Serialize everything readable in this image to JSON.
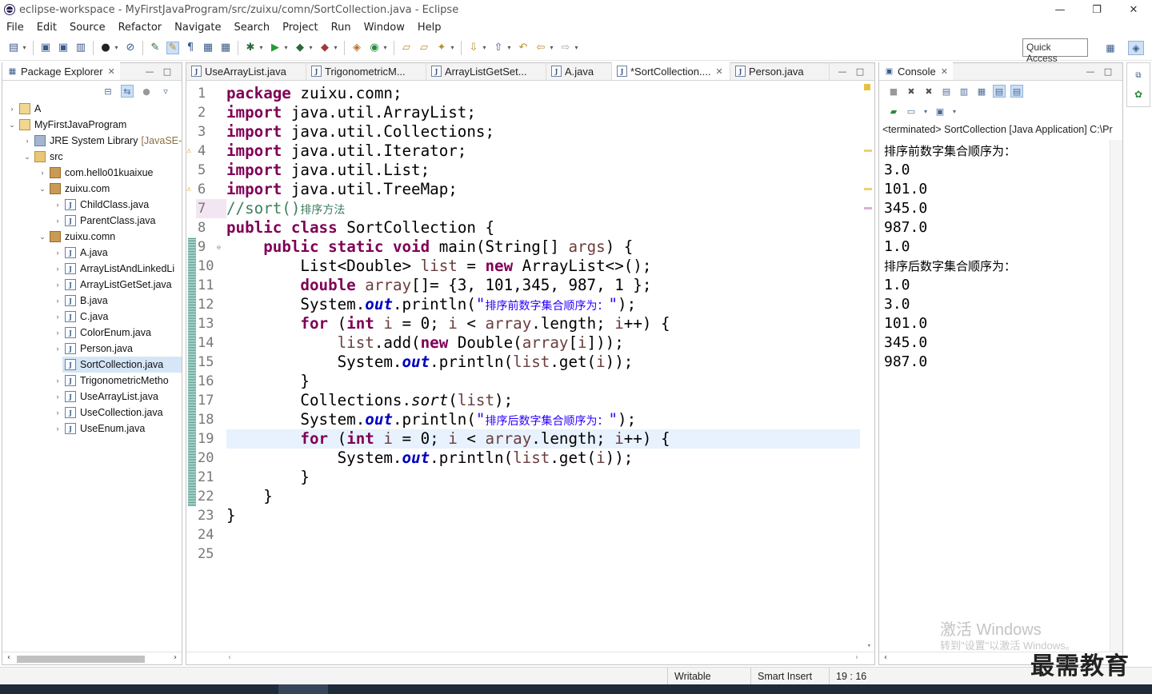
{
  "window": {
    "title": "eclipse-workspace - MyFirstJavaProgram/src/zuixu/comn/SortCollection.java - Eclipse",
    "minimize": "—",
    "restore": "❐",
    "close": "✕"
  },
  "menu": [
    "File",
    "Edit",
    "Source",
    "Refactor",
    "Navigate",
    "Search",
    "Project",
    "Run",
    "Window",
    "Help"
  ],
  "toolbar": {
    "quick_access": "Quick Access"
  },
  "package_explorer": {
    "title": "Package Explorer",
    "close": "✕",
    "tree": [
      {
        "label": "A",
        "extra": "",
        "icon": "project-icon"
      },
      {
        "label": "MyFirstJavaProgram",
        "extra": "",
        "icon": "project-icon"
      },
      {
        "label": "JRE System Library",
        "extra": "[JavaSE-",
        "icon": "library-icon"
      },
      {
        "label": "src",
        "extra": "",
        "icon": "source-folder-icon"
      },
      {
        "label": "com.hello01kuaixue",
        "extra": "",
        "icon": "package-icon"
      },
      {
        "label": "zuixu.com",
        "extra": "",
        "icon": "package-icon"
      },
      {
        "label": "ChildClass.java",
        "extra": "",
        "icon": "java-file-icon"
      },
      {
        "label": "ParentClass.java",
        "extra": "",
        "icon": "java-file-icon"
      },
      {
        "label": "zuixu.comn",
        "extra": "",
        "icon": "package-icon"
      },
      {
        "label": "A.java",
        "extra": "",
        "icon": "java-file-icon"
      },
      {
        "label": "ArrayListAndLinkedLi",
        "extra": "",
        "icon": "java-file-icon"
      },
      {
        "label": "ArrayListGetSet.java",
        "extra": "",
        "icon": "java-file-icon"
      },
      {
        "label": "B.java",
        "extra": "",
        "icon": "java-file-icon"
      },
      {
        "label": "C.java",
        "extra": "",
        "icon": "java-file-icon"
      },
      {
        "label": "ColorEnum.java",
        "extra": "",
        "icon": "java-file-icon"
      },
      {
        "label": "Person.java",
        "extra": "",
        "icon": "java-file-icon"
      },
      {
        "label": "SortCollection.java",
        "extra": "",
        "icon": "java-file-icon"
      },
      {
        "label": "TrigonometricMetho",
        "extra": "",
        "icon": "java-file-icon"
      },
      {
        "label": "UseArrayList.java",
        "extra": "",
        "icon": "java-file-icon"
      },
      {
        "label": "UseCollection.java",
        "extra": "",
        "icon": "java-file-icon"
      },
      {
        "label": "UseEnum.java",
        "extra": "",
        "icon": "java-file-icon"
      }
    ]
  },
  "editor": {
    "tabs": [
      {
        "label": "UseArrayList.java"
      },
      {
        "label": "TrigonometricM..."
      },
      {
        "label": "ArrayListGetSet..."
      },
      {
        "label": "A.java"
      },
      {
        "label": "*SortCollection...."
      },
      {
        "label": "Person.java"
      }
    ],
    "active_tab": 4,
    "line_numbers": [
      "1",
      "2",
      "3",
      "4",
      "5",
      "6",
      "7",
      "8",
      "9",
      "10",
      "11",
      "12",
      "13",
      "14",
      "15",
      "16",
      "17",
      "18",
      "19",
      "20",
      "21",
      "22",
      "23",
      "24",
      "25"
    ],
    "current_line": 19
  },
  "console": {
    "title": "Console",
    "close": "✕",
    "header": "<terminated> SortCollection [Java Application] C:\\Pr",
    "output": [
      "排序前数字集合顺序为：",
      "3.0",
      "101.0",
      "345.0",
      "987.0",
      "1.0",
      "排序后数字集合顺序为：",
      "1.0",
      "3.0",
      "101.0",
      "345.0",
      "987.0"
    ],
    "watermark_line1": "激活 Windows",
    "watermark_line2": "转到\"设置\"以激活 Windows。"
  },
  "status_bar": {
    "writable": "Writable",
    "insert_mode": "Smart Insert",
    "position": "19 : 16"
  },
  "brand": "最需教育"
}
